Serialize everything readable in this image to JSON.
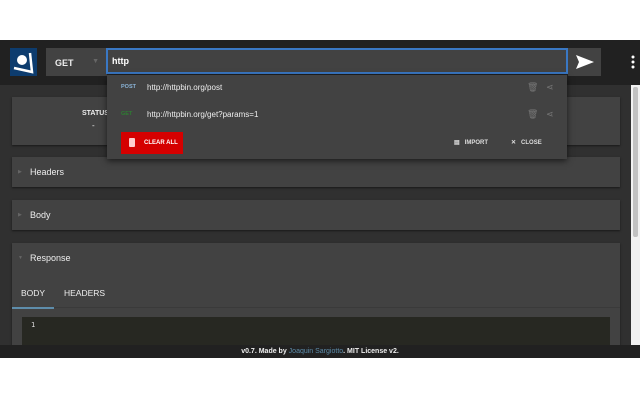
{
  "header": {
    "method": "GET",
    "url": "http"
  },
  "status": {
    "label": "STATUS",
    "value": "-"
  },
  "panels": {
    "headers": "Headers",
    "body": "Body",
    "response": "Response"
  },
  "response_tabs": [
    "BODY",
    "HEADERS"
  ],
  "editor": {
    "line": "1"
  },
  "footer": {
    "prefix": "v0.7. Made by ",
    "author": "Joaquin Sargiotto",
    "suffix": ". MIT License v2."
  },
  "history": {
    "items": [
      {
        "method": "POST",
        "url": "http://httpbin.org/post",
        "color": "#8ab4d8"
      },
      {
        "method": "GET",
        "url": "http://httpbin.org/get?params=1",
        "color": "#2e7d32"
      }
    ],
    "clear_all": "CLEAR ALL",
    "import": "IMPORT",
    "close": "CLOSE"
  },
  "colors": {
    "accent": "#3a78c4",
    "danger": "#d50000"
  }
}
